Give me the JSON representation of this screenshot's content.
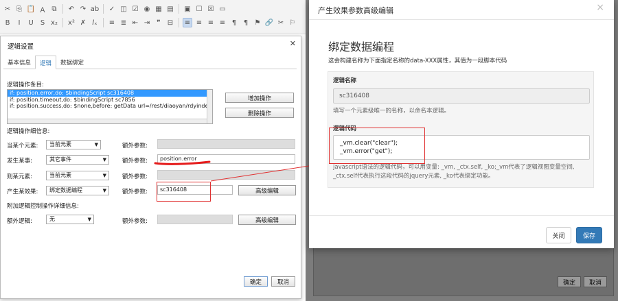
{
  "toolbar": {
    "row1": [
      "✂",
      "⎘",
      "📋",
      "Ａ",
      "⧉",
      "↶",
      "↷",
      "ab",
      "✓",
      "◫",
      "☑",
      "◉",
      "▦",
      "▤",
      "▣",
      "☐",
      "☒",
      "▭"
    ],
    "row2": [
      "B",
      "I",
      "U",
      "S",
      "x₂",
      "x²",
      "✗",
      "𝐼ₓ",
      "≡",
      "≣",
      "⇤",
      "⇥",
      "❞",
      "⊟",
      "≡",
      "≡",
      "≡",
      "≡",
      "¶",
      "¶",
      "⚑",
      "🔗",
      "✂",
      "⚐"
    ]
  },
  "logic_dialog": {
    "title": "逻辑设置",
    "tabs": [
      "基本信息",
      "逻辑",
      "数据绑定"
    ],
    "active_tab": 1,
    "ops_label": "逻辑操作条目:",
    "ops": [
      "if: position.error,do: $bindingScript sc316408",
      "if: position.timeout,do: $bindingScript sc7856",
      "if: position.success,do: $none,before: getData url=/rest/diaoyan/rdyindexx.jso"
    ],
    "add_btn": "增加操作",
    "del_btn": "删除操作",
    "detail_label": "逻辑操作细信息:",
    "rows": [
      {
        "label": "当某个元素:",
        "select": "当前元素",
        "extra_label": "额外参数:",
        "extra_value": ""
      },
      {
        "label": "发生某事:",
        "select": "其它事件",
        "extra_label": "额外参数:",
        "extra_value": "position.error"
      },
      {
        "label": "则某元素:",
        "select": "当前元素",
        "extra_label": "额外参数:",
        "extra_value": ""
      },
      {
        "label": "产生某效果:",
        "select": "绑定数据编程",
        "extra_label": "额外参数:",
        "extra_value": "sc316408"
      }
    ],
    "adv_btn": "高级编辑",
    "attach_label": "附加逻辑控制操作详细信息:",
    "extra_logic_label": "额外逻辑:",
    "extra_logic_select": "无",
    "extra_logic_param_label": "额外参数:",
    "adv_btn2": "高级编辑",
    "ok_btn": "确定",
    "cancel_btn": "取消"
  },
  "bg_dialog": {
    "ok_btn": "确定",
    "cancel_btn": "取消"
  },
  "adv_modal": {
    "title": "产生效果参数高级编辑",
    "heading": "绑定数据编程",
    "desc": "这会构建名称为下面指定名称的data-XXX属性，其值为一段脚本代码",
    "name_label": "逻辑名称",
    "name_value": "sc316408",
    "name_help": "填写一个元素级唯一的名称，以命名本逻辑。",
    "code_label": "逻辑代码",
    "code_lines": [
      "_vm.clear(\"clear\");",
      "_vm.error(\"get\");"
    ],
    "code_help": "javascript语法的逻辑代码，可以用变量: _vm, _ctx.self, _ko;_vm代表了逻辑视图变量空间, _ctx.self代表执行这段代码的jquery元素, _ko代表绑定功能。",
    "close_btn": "关闭",
    "save_btn": "保存"
  }
}
